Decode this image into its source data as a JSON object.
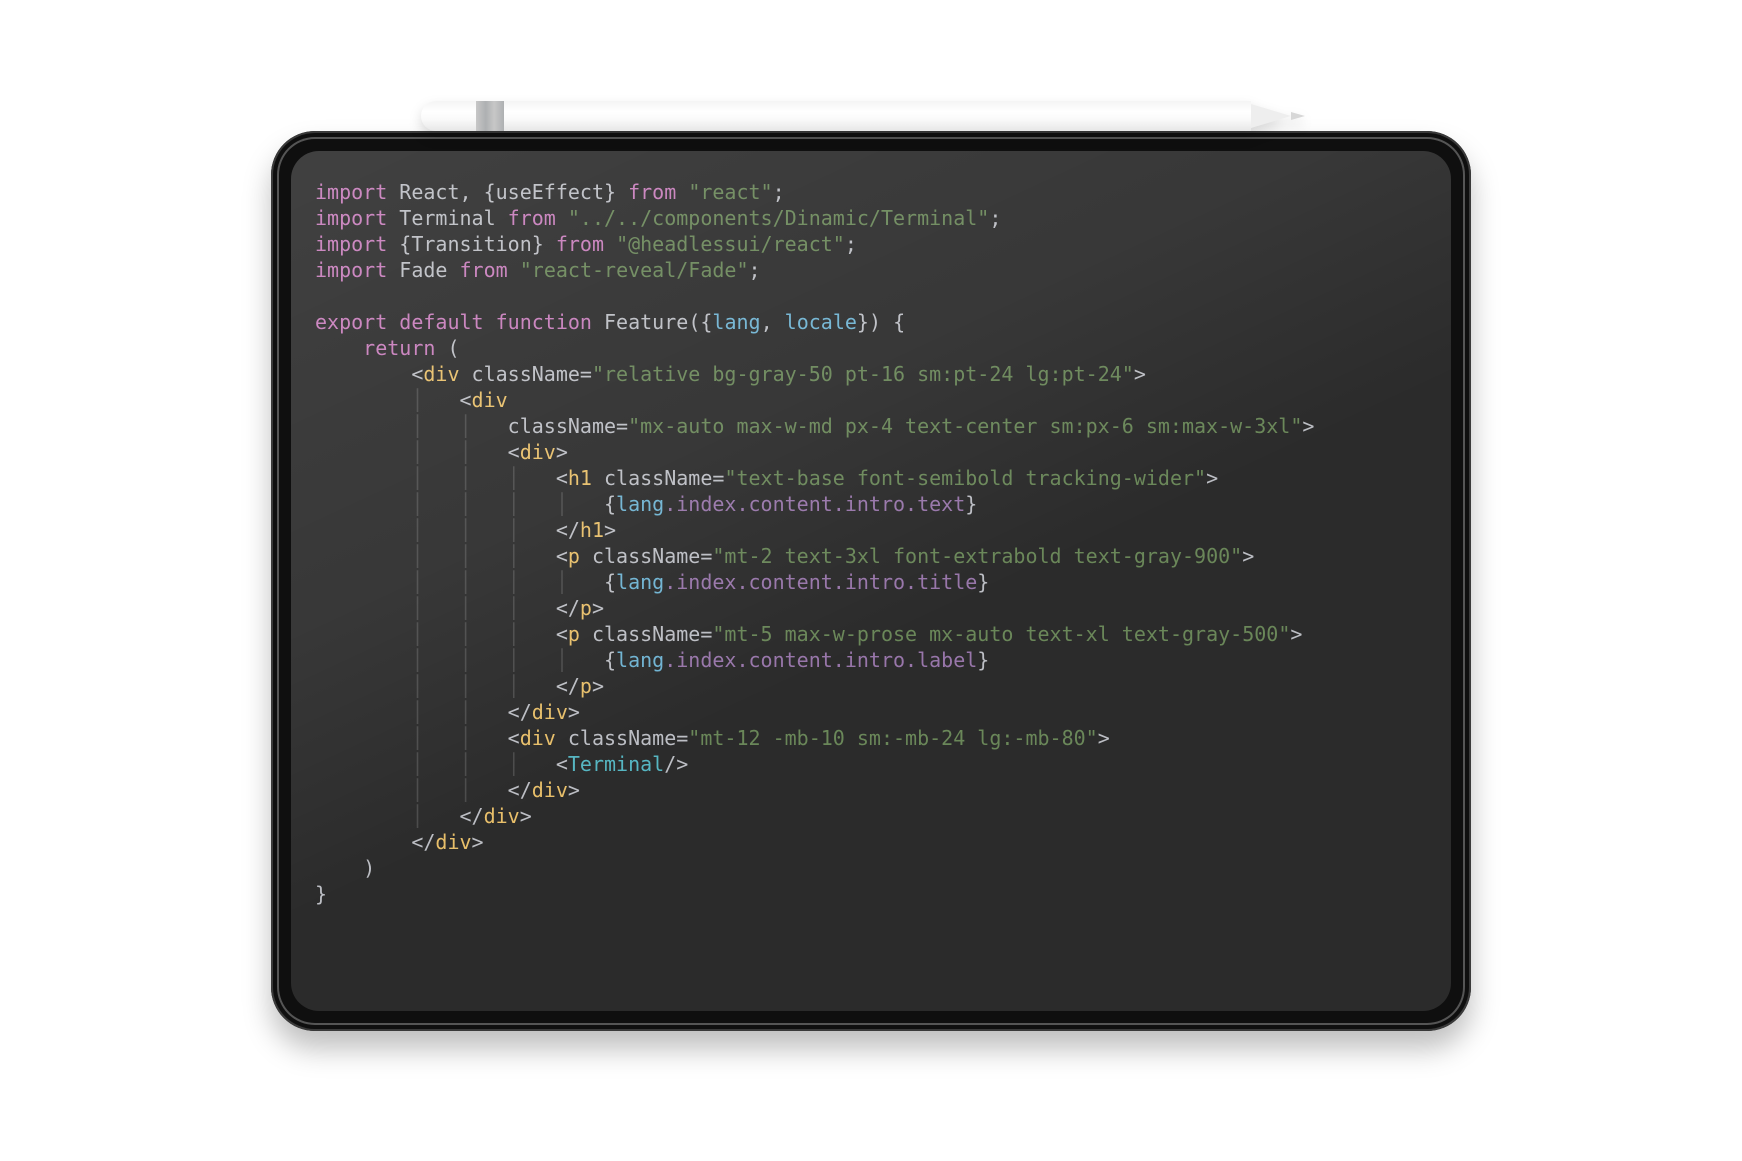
{
  "imports": [
    {
      "kw1": "import",
      "spec": "React, {useEffect}",
      "kw2": "from",
      "path": "\"react\"",
      "semi": ";"
    },
    {
      "kw1": "import",
      "spec": "Terminal",
      "kw2": "from",
      "path": "\"../../components/Dinamic/Terminal\"",
      "semi": ";"
    },
    {
      "kw1": "import",
      "spec": "{Transition}",
      "kw2": "from",
      "path": "\"@headlessui/react\"",
      "semi": ";"
    },
    {
      "kw1": "import",
      "spec": "Fade",
      "kw2": "from",
      "path": "\"react-reveal/Fade\"",
      "semi": ";"
    }
  ],
  "fn": {
    "export": "export",
    "default": "default",
    "function": "function",
    "name": "Feature",
    "params_open": "({",
    "param1": "lang",
    "comma": ",",
    "param2": "locale",
    "params_close": "})",
    "brace_open": "{",
    "return": "return",
    "paren_open": "("
  },
  "jsx": {
    "div1_open_lt": "<",
    "div1_tag": "div",
    "div1_attr": "className",
    "div1_val": "\"relative bg-gray-50 pt-16 sm:pt-24 lg:pt-24\"",
    "gt": ">",
    "div2_open_lt": "<",
    "div2_tag": "div",
    "div2_attr": "className",
    "div2_val": "\"mx-auto max-w-md px-4 text-center sm:px-6 sm:max-w-3xl\"",
    "div3_open_lt": "<",
    "div3_tag": "div",
    "h1_lt": "<",
    "h1_tag": "h1",
    "h1_attr": "className",
    "h1_val": "\"text-base font-semibold tracking-wider\"",
    "expr1_open": "{",
    "expr1_obj": "lang",
    "expr1_p1": ".index",
    "expr1_p2": ".content",
    "expr1_p3": ".intro",
    "expr1_p4": ".text",
    "expr1_close": "}",
    "h1_close_lt": "</",
    "h1_close_tag": "h1",
    "p1_lt": "<",
    "p1_tag": "p",
    "p1_attr": "className",
    "p1_val": "\"mt-2 text-3xl font-extrabold text-gray-900\"",
    "expr2_open": "{",
    "expr2_obj": "lang",
    "expr2_p1": ".index",
    "expr2_p2": ".content",
    "expr2_p3": ".intro",
    "expr2_p4": ".title",
    "expr2_close": "}",
    "p_close_lt": "</",
    "p_close_tag": "p",
    "p2_lt": "<",
    "p2_tag": "p",
    "p2_attr": "className",
    "p2_val": "\"mt-5 max-w-prose mx-auto text-xl text-gray-500\"",
    "expr3_open": "{",
    "expr3_obj": "lang",
    "expr3_p1": ".index",
    "expr3_p2": ".content",
    "expr3_p3": ".intro",
    "expr3_p4": ".label",
    "expr3_close": "}",
    "div3_close_lt": "</",
    "div3_close_tag": "div",
    "div4_open_lt": "<",
    "div4_tag": "div",
    "div4_attr": "className",
    "div4_val": "\"mt-12 -mb-10 sm:-mb-24 lg:-mb-80\"",
    "terminal_lt": "<",
    "terminal_tag": "Terminal",
    "terminal_selfclose": "/>",
    "div4_close_lt": "</",
    "div4_close_tag": "div",
    "div2_close_lt": "</",
    "div2_close_tag": "div",
    "div1_close_lt": "</",
    "div1_close_tag": "div"
  },
  "tail": {
    "paren_close": ")",
    "brace_close": "}"
  }
}
